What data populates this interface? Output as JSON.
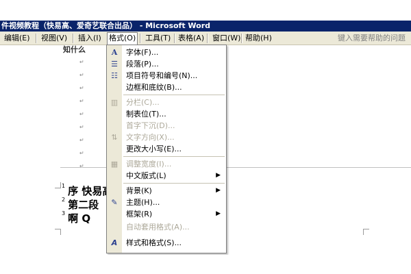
{
  "window": {
    "title": "件视频教程（快易高、爱奇艺联合出品） - Microsoft Word"
  },
  "menubar": {
    "items": [
      {
        "label": "编辑(E)"
      },
      {
        "label": "视图(V)"
      },
      {
        "label": "插入(I)"
      },
      {
        "label": "格式(O)"
      },
      {
        "label": "工具(T)"
      },
      {
        "label": "表格(A)"
      },
      {
        "label": "窗口(W)"
      },
      {
        "label": "帮助(H)"
      }
    ],
    "help_placeholder": "键入需要帮助的问题"
  },
  "document": {
    "top_text": "知什么",
    "para_mark": "↵",
    "footnotes": [
      {
        "num": "1",
        "text": "序 快易高"
      },
      {
        "num": "2",
        "text": "第二段"
      },
      {
        "num": "3",
        "text": "啊 Q"
      }
    ]
  },
  "format_menu": {
    "items": [
      {
        "label": "字体(F)...",
        "icon": "font-icon",
        "disabled": false
      },
      {
        "label": "段落(P)...",
        "icon": "paragraph-icon",
        "disabled": false
      },
      {
        "label": "项目符号和编号(N)...",
        "icon": "bullets-icon",
        "disabled": false
      },
      {
        "label": "边框和底纹(B)...",
        "icon": "",
        "disabled": false
      },
      {
        "label": "分栏(C)...",
        "icon": "columns-icon",
        "disabled": true
      },
      {
        "label": "制表位(T)...",
        "icon": "",
        "disabled": false
      },
      {
        "label": "首字下沉(D)...",
        "icon": "",
        "disabled": true
      },
      {
        "label": "文字方向(X)...",
        "icon": "text-direction-icon",
        "disabled": true
      },
      {
        "label": "更改大小写(E)...",
        "icon": "",
        "disabled": false
      },
      {
        "label": "调整宽度(I)...",
        "icon": "fit-width-icon",
        "disabled": true
      },
      {
        "label": "中文版式(L)",
        "icon": "",
        "disabled": false,
        "submenu": true
      },
      {
        "label": "背景(K)",
        "icon": "",
        "disabled": false,
        "submenu": true
      },
      {
        "label": "主题(H)...",
        "icon": "theme-icon",
        "disabled": false
      },
      {
        "label": "框架(R)",
        "icon": "",
        "disabled": false,
        "submenu": true
      },
      {
        "label": "自动套用格式(A)...",
        "icon": "",
        "disabled": true
      },
      {
        "label": "样式和格式(S)...",
        "icon": "styles-icon",
        "disabled": false
      }
    ],
    "submenu_arrow": "▶"
  }
}
